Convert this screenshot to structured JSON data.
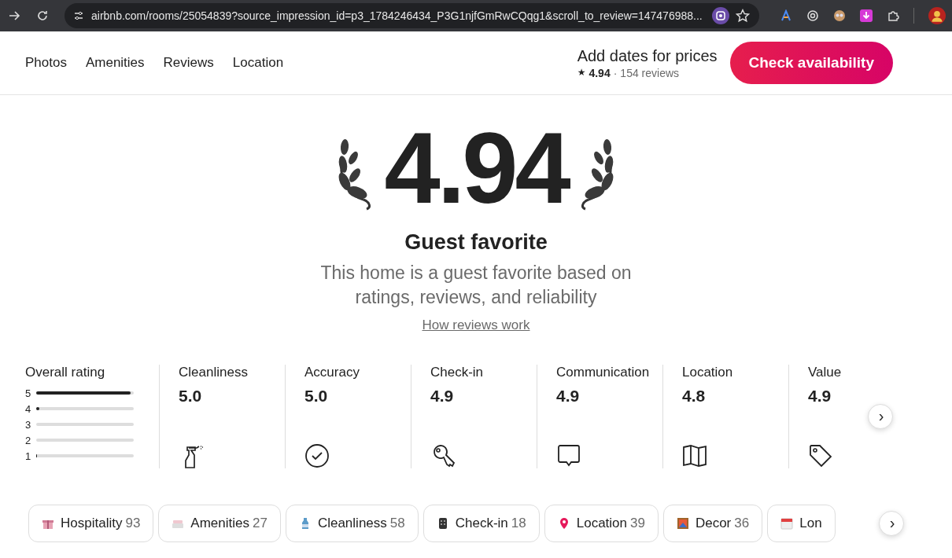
{
  "browser": {
    "url": "airbnb.com/rooms/25054839?source_impression_id=p3_1784246434_P3G1njfGmRwCQqg1&scroll_to_review=147476988..."
  },
  "nav": {
    "links": [
      "Photos",
      "Amenities",
      "Reviews",
      "Location"
    ],
    "price_prompt": "Add dates for prices",
    "star": "★",
    "rating": "4.94",
    "separator": "·",
    "reviews": "154 reviews",
    "cta": "Check availability"
  },
  "hero": {
    "score": "4.94",
    "title": "Guest favorite",
    "subtitle": "This home is a guest favorite based on ratings, reviews, and reliability",
    "link": "How reviews work"
  },
  "overall": {
    "label": "Overall rating",
    "bars": [
      {
        "stars": "5",
        "level": 0.97
      },
      {
        "stars": "4",
        "level": 0.03
      },
      {
        "stars": "3"
      },
      {
        "stars": "2"
      },
      {
        "stars": "1",
        "level": 0.01
      }
    ]
  },
  "categories": [
    {
      "label": "Cleanliness",
      "score": "5.0",
      "kind": "spray"
    },
    {
      "label": "Accuracy",
      "score": "5.0",
      "kind": "check"
    },
    {
      "label": "Check-in",
      "score": "4.9",
      "kind": "key"
    },
    {
      "label": "Communication",
      "score": "4.9",
      "kind": "chat"
    },
    {
      "label": "Location",
      "score": "4.8",
      "kind": "map"
    },
    {
      "label": "Value",
      "score": "4.9",
      "kind": "tag"
    }
  ],
  "next_arrow": "›",
  "chips": [
    {
      "label": "Hospitality",
      "count": "93",
      "kind": "gift"
    },
    {
      "label": "Amenities",
      "count": "27",
      "kind": "towels"
    },
    {
      "label": "Cleanliness",
      "count": "58",
      "kind": "bottle"
    },
    {
      "label": "Check-in",
      "count": "18",
      "kind": "keypad"
    },
    {
      "label": "Location",
      "count": "39",
      "kind": "pin"
    },
    {
      "label": "Decor",
      "count": "36",
      "kind": "frame"
    },
    {
      "label": "Lon",
      "kind": "calendar"
    }
  ],
  "chips_arrow": "›"
}
